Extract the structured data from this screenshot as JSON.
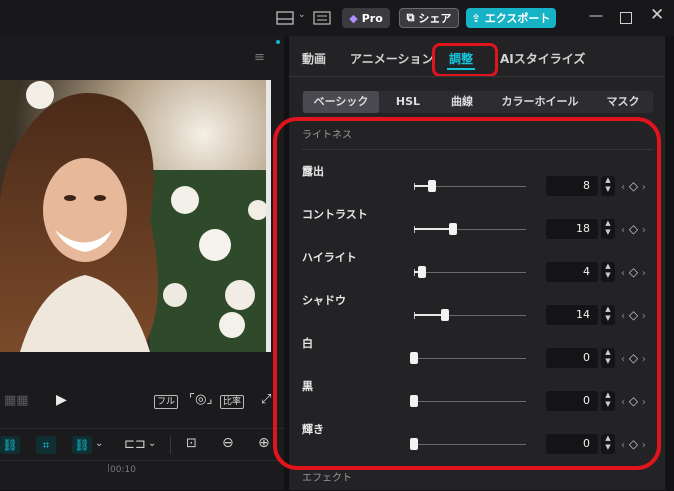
{
  "titlebar": {
    "layout_icon": "layout-icon",
    "shortcut_icon": "keyboard-icon",
    "pro_label": "Pro",
    "share_label": "シェア",
    "export_label": "エクスポート",
    "window_controls": [
      "minimize-icon",
      "maximize-icon",
      "close-icon"
    ]
  },
  "player": {
    "controls": {
      "full_label": "フル",
      "ratio_label": "比率"
    },
    "timecode": "00:10"
  },
  "panel": {
    "tabs": [
      "動画",
      "アニメーション",
      "調整",
      "AIスタイライズ"
    ],
    "active_tab": "調整",
    "subtabs": [
      "ベーシック",
      "HSL",
      "曲線",
      "カラーホイール",
      "マスク"
    ],
    "active_subtab": "ベーシック",
    "section_title": "ライトネス",
    "next_section": "エフェクト",
    "sliders": [
      {
        "label": "露出",
        "value": "8"
      },
      {
        "label": "コントラスト",
        "value": "18"
      },
      {
        "label": "ハイライト",
        "value": "4"
      },
      {
        "label": "シャドウ",
        "value": "14"
      },
      {
        "label": "白",
        "value": "0"
      },
      {
        "label": "黒",
        "value": "0"
      },
      {
        "label": "輝き",
        "value": "0"
      }
    ]
  },
  "colors": {
    "accent": "#16b2c6",
    "highlight_annotation": "#e0141c",
    "panel_bg": "#232326"
  }
}
